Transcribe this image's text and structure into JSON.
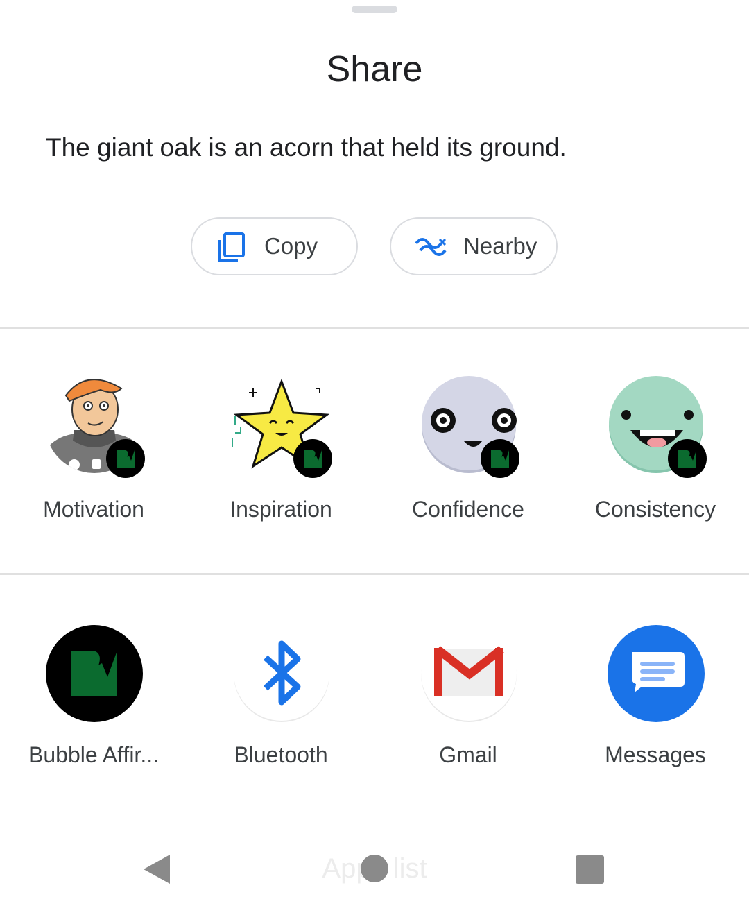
{
  "sheet": {
    "title": "Share",
    "shared_text": "The giant oak is an acorn that held its ground."
  },
  "actions": {
    "copy_label": "Copy",
    "nearby_label": "Nearby"
  },
  "direct_share": [
    {
      "label": "Motivation",
      "icon": "person-sticker-icon"
    },
    {
      "label": "Inspiration",
      "icon": "star-sticker-icon"
    },
    {
      "label": "Confidence",
      "icon": "face-sticker-icon"
    },
    {
      "label": "Consistency",
      "icon": "smile-sticker-icon"
    }
  ],
  "apps": [
    {
      "label": "Bubble Affir...",
      "icon": "bubble-affirmations-icon"
    },
    {
      "label": "Bluetooth",
      "icon": "bluetooth-icon"
    },
    {
      "label": "Gmail",
      "icon": "gmail-icon"
    },
    {
      "label": "Messages",
      "icon": "messages-icon"
    }
  ],
  "navbar": {
    "hint": "Apps list",
    "back_icon": "back-icon",
    "home_icon": "home-icon",
    "recents_icon": "recents-icon"
  },
  "colors": {
    "accent_blue": "#1a73e8",
    "app_green": "#0b6b2f",
    "messages_blue": "#1a73e8",
    "gmail_red": "#d93025"
  }
}
